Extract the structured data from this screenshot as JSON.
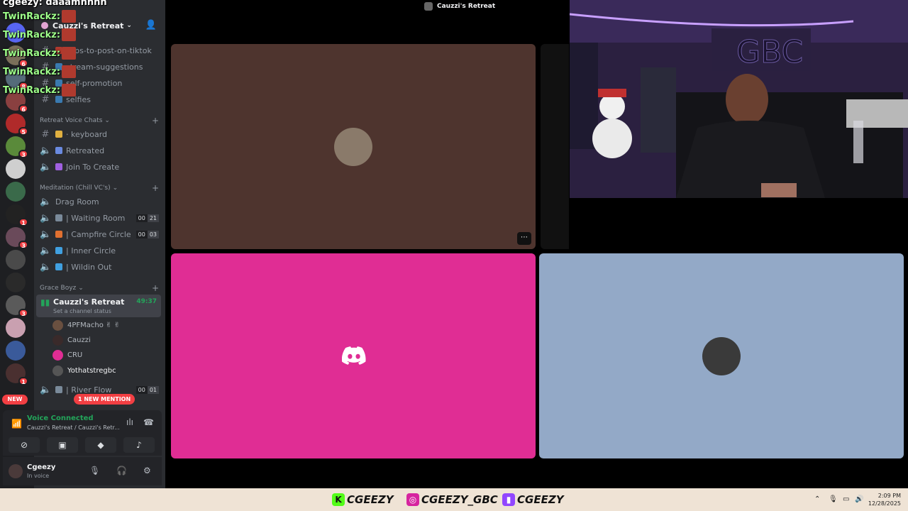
{
  "window": {
    "title": "Cauzzi's Retreat"
  },
  "server": {
    "name": "Cauzzi's Retreat"
  },
  "channels": {
    "text": [
      {
        "name": "clips-to-post-on-tiktok"
      },
      {
        "name": "stream-suggestions"
      },
      {
        "name": "self-promotion"
      },
      {
        "name": "selfies"
      }
    ],
    "categories": {
      "retreat_voice": "Retreat Voice Chats",
      "meditation": "Meditation (Chill VC's)",
      "grace": "Grace Boyz"
    },
    "retreat_voice": [
      {
        "name": "· keyboard"
      },
      {
        "name": "Retreated"
      },
      {
        "name": "Join To Create"
      }
    ],
    "meditation": [
      {
        "name": "Drag Room"
      },
      {
        "name": "| Waiting Room",
        "c1": "00",
        "c2": "21"
      },
      {
        "name": "| Campfire Circle",
        "c1": "00",
        "c2": "03"
      },
      {
        "name": "| Inner Circle"
      },
      {
        "name": "| Wildin Out"
      }
    ],
    "active": {
      "name": "Cauzzi's Retreat",
      "timer": "49:37",
      "status": "Set a channel status"
    },
    "members": [
      {
        "name": "4PFMacho ✌ ✌"
      },
      {
        "name": "Cauzzi"
      },
      {
        "name": "CRU"
      },
      {
        "name": "Yothatstregbc"
      }
    ],
    "river": {
      "name": "| River Flow",
      "c1": "00",
      "c2": "01"
    }
  },
  "rail": {
    "badges": [
      "6",
      "8",
      "6",
      "5",
      "3",
      "1",
      "3",
      "3",
      "1"
    ],
    "new_label": "NEW"
  },
  "mention_pill": "1 NEW MENTION",
  "voice_panel": {
    "title": "Voice Connected",
    "subtitle": "Cauzzi's Retreat / Cauzzi's Retr..."
  },
  "user": {
    "name": "Cgeezy",
    "status": "In voice"
  },
  "chat_overlay": {
    "header": "cgeezy: daaamnnnn",
    "lines": [
      {
        "user": "TwinRackz:"
      },
      {
        "user": "TwinRackz:"
      },
      {
        "user": "TwinRackz:"
      },
      {
        "user": "TwinRackz:"
      },
      {
        "user": "TwinRackz:"
      }
    ]
  },
  "webcam": {
    "sign_text": "GBC"
  },
  "taskbar": {
    "social": [
      {
        "platform": "kick",
        "handle": "CGEEZY"
      },
      {
        "platform": "instagram",
        "handle": "CGEEZY_GBC"
      },
      {
        "platform": "twitch",
        "handle": "CGEEZY"
      }
    ],
    "time": "2:09 PM",
    "date": "12/28/2025"
  },
  "colors": {
    "tile1": "#4e342e",
    "tile2": "#e02d94",
    "tile3": "#93a9c7",
    "voice_green": "#23a55a",
    "mention_red": "#f23f43"
  }
}
